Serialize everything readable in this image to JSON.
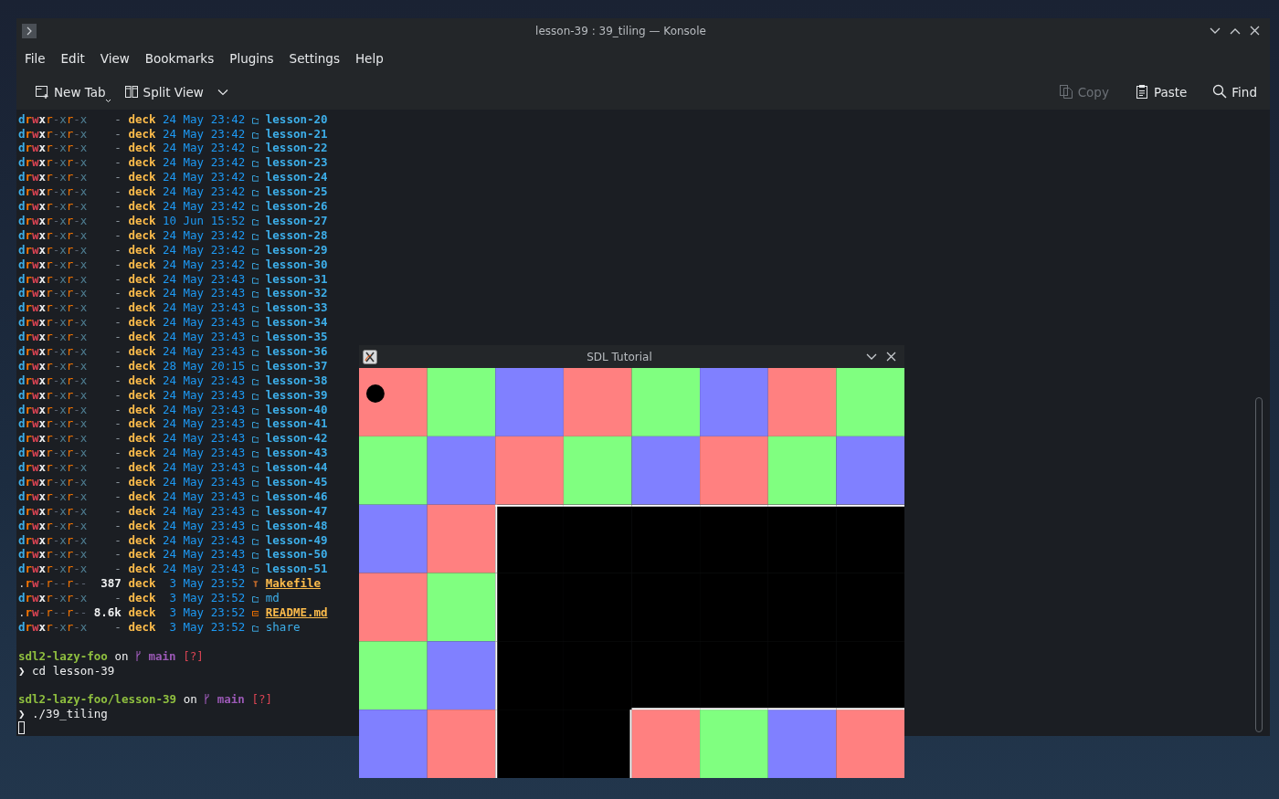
{
  "window": {
    "title": "lesson-39 : 39_tiling — Konsole"
  },
  "menu": [
    "File",
    "Edit",
    "View",
    "Bookmarks",
    "Plugins",
    "Settings",
    "Help"
  ],
  "toolbar_left": [
    {
      "label": "New Tab",
      "kind": "new-tab",
      "disabled": false
    },
    {
      "label": "Split View",
      "kind": "split-view",
      "disabled": false
    }
  ],
  "toolbar_right": [
    {
      "label": "Copy",
      "kind": "copy",
      "disabled": true
    },
    {
      "label": "Paste",
      "kind": "paste",
      "disabled": false
    },
    {
      "label": "Find",
      "kind": "find",
      "disabled": false
    }
  ],
  "listing": [
    {
      "permissions": "drwxr-xr-x",
      "size": "-",
      "user": "deck",
      "date": "24 May",
      "time": "23:42",
      "name": "lesson-20",
      "kind": "folder"
    },
    {
      "permissions": "drwxr-xr-x",
      "size": "-",
      "user": "deck",
      "date": "24 May",
      "time": "23:42",
      "name": "lesson-21",
      "kind": "folder"
    },
    {
      "permissions": "drwxr-xr-x",
      "size": "-",
      "user": "deck",
      "date": "24 May",
      "time": "23:42",
      "name": "lesson-22",
      "kind": "folder"
    },
    {
      "permissions": "drwxr-xr-x",
      "size": "-",
      "user": "deck",
      "date": "24 May",
      "time": "23:42",
      "name": "lesson-23",
      "kind": "folder"
    },
    {
      "permissions": "drwxr-xr-x",
      "size": "-",
      "user": "deck",
      "date": "24 May",
      "time": "23:42",
      "name": "lesson-24",
      "kind": "folder"
    },
    {
      "permissions": "drwxr-xr-x",
      "size": "-",
      "user": "deck",
      "date": "24 May",
      "time": "23:42",
      "name": "lesson-25",
      "kind": "folder"
    },
    {
      "permissions": "drwxr-xr-x",
      "size": "-",
      "user": "deck",
      "date": "24 May",
      "time": "23:42",
      "name": "lesson-26",
      "kind": "folder"
    },
    {
      "permissions": "drwxr-xr-x",
      "size": "-",
      "user": "deck",
      "date": "10 Jun",
      "time": "15:52",
      "name": "lesson-27",
      "kind": "folder"
    },
    {
      "permissions": "drwxr-xr-x",
      "size": "-",
      "user": "deck",
      "date": "24 May",
      "time": "23:42",
      "name": "lesson-28",
      "kind": "folder"
    },
    {
      "permissions": "drwxr-xr-x",
      "size": "-",
      "user": "deck",
      "date": "24 May",
      "time": "23:42",
      "name": "lesson-29",
      "kind": "folder"
    },
    {
      "permissions": "drwxr-xr-x",
      "size": "-",
      "user": "deck",
      "date": "24 May",
      "time": "23:42",
      "name": "lesson-30",
      "kind": "folder"
    },
    {
      "permissions": "drwxr-xr-x",
      "size": "-",
      "user": "deck",
      "date": "24 May",
      "time": "23:43",
      "name": "lesson-31",
      "kind": "folder"
    },
    {
      "permissions": "drwxr-xr-x",
      "size": "-",
      "user": "deck",
      "date": "24 May",
      "time": "23:43",
      "name": "lesson-32",
      "kind": "folder"
    },
    {
      "permissions": "drwxr-xr-x",
      "size": "-",
      "user": "deck",
      "date": "24 May",
      "time": "23:43",
      "name": "lesson-33",
      "kind": "folder"
    },
    {
      "permissions": "drwxr-xr-x",
      "size": "-",
      "user": "deck",
      "date": "24 May",
      "time": "23:43",
      "name": "lesson-34",
      "kind": "folder"
    },
    {
      "permissions": "drwxr-xr-x",
      "size": "-",
      "user": "deck",
      "date": "24 May",
      "time": "23:43",
      "name": "lesson-35",
      "kind": "folder"
    },
    {
      "permissions": "drwxr-xr-x",
      "size": "-",
      "user": "deck",
      "date": "24 May",
      "time": "23:43",
      "name": "lesson-36",
      "kind": "folder"
    },
    {
      "permissions": "drwxr-xr-x",
      "size": "-",
      "user": "deck",
      "date": "28 May",
      "time": "20:15",
      "name": "lesson-37",
      "kind": "folder"
    },
    {
      "permissions": "drwxr-xr-x",
      "size": "-",
      "user": "deck",
      "date": "24 May",
      "time": "23:43",
      "name": "lesson-38",
      "kind": "folder"
    },
    {
      "permissions": "drwxr-xr-x",
      "size": "-",
      "user": "deck",
      "date": "24 May",
      "time": "23:43",
      "name": "lesson-39",
      "kind": "folder"
    },
    {
      "permissions": "drwxr-xr-x",
      "size": "-",
      "user": "deck",
      "date": "24 May",
      "time": "23:43",
      "name": "lesson-40",
      "kind": "folder"
    },
    {
      "permissions": "drwxr-xr-x",
      "size": "-",
      "user": "deck",
      "date": "24 May",
      "time": "23:43",
      "name": "lesson-41",
      "kind": "folder"
    },
    {
      "permissions": "drwxr-xr-x",
      "size": "-",
      "user": "deck",
      "date": "24 May",
      "time": "23:43",
      "name": "lesson-42",
      "kind": "folder"
    },
    {
      "permissions": "drwxr-xr-x",
      "size": "-",
      "user": "deck",
      "date": "24 May",
      "time": "23:43",
      "name": "lesson-43",
      "kind": "folder"
    },
    {
      "permissions": "drwxr-xr-x",
      "size": "-",
      "user": "deck",
      "date": "24 May",
      "time": "23:43",
      "name": "lesson-44",
      "kind": "folder"
    },
    {
      "permissions": "drwxr-xr-x",
      "size": "-",
      "user": "deck",
      "date": "24 May",
      "time": "23:43",
      "name": "lesson-45",
      "kind": "folder"
    },
    {
      "permissions": "drwxr-xr-x",
      "size": "-",
      "user": "deck",
      "date": "24 May",
      "time": "23:43",
      "name": "lesson-46",
      "kind": "folder"
    },
    {
      "permissions": "drwxr-xr-x",
      "size": "-",
      "user": "deck",
      "date": "24 May",
      "time": "23:43",
      "name": "lesson-47",
      "kind": "folder"
    },
    {
      "permissions": "drwxr-xr-x",
      "size": "-",
      "user": "deck",
      "date": "24 May",
      "time": "23:43",
      "name": "lesson-48",
      "kind": "folder"
    },
    {
      "permissions": "drwxr-xr-x",
      "size": "-",
      "user": "deck",
      "date": "24 May",
      "time": "23:43",
      "name": "lesson-49",
      "kind": "folder"
    },
    {
      "permissions": "drwxr-xr-x",
      "size": "-",
      "user": "deck",
      "date": "24 May",
      "time": "23:43",
      "name": "lesson-50",
      "kind": "folder"
    },
    {
      "permissions": "drwxr-xr-x",
      "size": "-",
      "user": "deck",
      "date": "24 May",
      "time": "23:43",
      "name": "lesson-51",
      "kind": "folder"
    },
    {
      "permissions": ".rw-r--r--",
      "size": "387",
      "user": "deck",
      "date": "3 May",
      "time": "23:52",
      "name": "Makefile",
      "kind": "makefile"
    },
    {
      "permissions": "drwxr-xr-x",
      "size": "-",
      "user": "deck",
      "date": "3 May",
      "time": "23:52",
      "name": "md",
      "kind": "plain-folder"
    },
    {
      "permissions": ".rw-r--r--",
      "size": "8.6k",
      "user": "deck",
      "date": "3 May",
      "time": "23:52",
      "name": "README.md",
      "kind": "readme"
    },
    {
      "permissions": "drwxr-xr-x",
      "size": "-",
      "user": "deck",
      "date": "3 May",
      "time": "23:52",
      "name": "share",
      "kind": "plain-folder"
    }
  ],
  "session": [
    {
      "kind": "blank"
    },
    {
      "kind": "prompt",
      "path": "sdl2-lazy-foo",
      "on": "on",
      "branch": "main",
      "status": "[?]"
    },
    {
      "kind": "command",
      "symbol": "❯",
      "text": "cd lesson-39"
    },
    {
      "kind": "blank"
    },
    {
      "kind": "prompt",
      "path": "sdl2-lazy-foo/lesson-39",
      "on": "on",
      "branch": "main",
      "status": "[?]"
    },
    {
      "kind": "command",
      "symbol": "❯",
      "text": "./39_tiling"
    },
    {
      "kind": "cursor"
    }
  ],
  "sdl_window": {
    "title": "SDL Tutorial",
    "tile_rows": [
      {
        "tiles": [
          {
            "color": "#ff8080"
          },
          {
            "color": "#80ff80"
          },
          {
            "color": "#8080ff"
          },
          {
            "color": "#ff8080"
          },
          {
            "color": "#80ff80"
          },
          {
            "color": "#8080ff"
          },
          {
            "color": "#ff8080"
          },
          {
            "color": "#80ff80"
          }
        ]
      },
      {
        "tiles": [
          {
            "color": "#80ff80"
          },
          {
            "color": "#8080ff"
          },
          {
            "color": "#ff8080"
          },
          {
            "color": "#80ff80"
          },
          {
            "color": "#8080ff"
          },
          {
            "color": "#ff8080"
          },
          {
            "color": "#80ff80"
          },
          {
            "color": "#8080ff"
          }
        ]
      },
      {
        "tiles": [
          {
            "color": "#8080ff"
          },
          {
            "color": "#ff8080"
          },
          {
            "color": "#000000"
          },
          {
            "color": "#000000"
          },
          {
            "color": "#000000"
          },
          {
            "color": "#000000"
          },
          {
            "color": "#000000"
          },
          {
            "color": "#000000"
          }
        ]
      },
      {
        "tiles": [
          {
            "color": "#ff8080"
          },
          {
            "color": "#80ff80"
          },
          {
            "color": "#000000"
          },
          {
            "color": "#000000"
          },
          {
            "color": "#000000"
          },
          {
            "color": "#000000"
          },
          {
            "color": "#000000"
          },
          {
            "color": "#000000"
          }
        ]
      },
      {
        "tiles": [
          {
            "color": "#80ff80"
          },
          {
            "color": "#8080ff"
          },
          {
            "color": "#000000"
          },
          {
            "color": "#000000"
          },
          {
            "color": "#000000"
          },
          {
            "color": "#000000"
          },
          {
            "color": "#000000"
          },
          {
            "color": "#000000"
          }
        ]
      },
      {
        "tiles": [
          {
            "color": "#8080ff"
          },
          {
            "color": "#ff8080"
          },
          {
            "color": "#000000"
          },
          {
            "color": "#000000"
          },
          {
            "color": "#ff8080"
          },
          {
            "color": "#80ff80"
          },
          {
            "color": "#8080ff"
          },
          {
            "color": "#ff8080"
          }
        ]
      }
    ]
  }
}
